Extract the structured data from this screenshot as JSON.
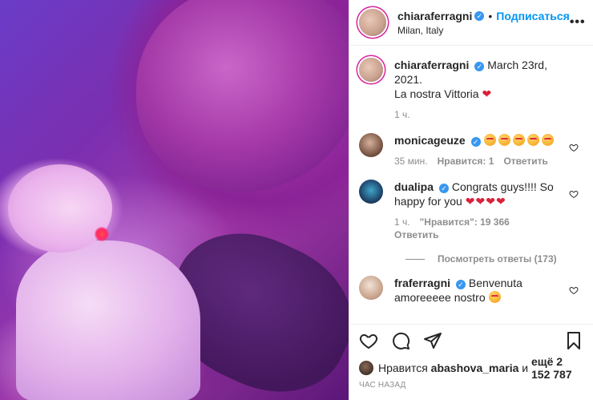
{
  "header": {
    "username": "chiaraferragni",
    "separator": "•",
    "follow_label": "Подписаться",
    "location": "Milan, Italy"
  },
  "caption": {
    "username": "chiaraferragni",
    "line1": "March 23rd, 2021.",
    "line2": "La nostra Vittoria",
    "time": "1 ч."
  },
  "comments": [
    {
      "username": "monicageuze",
      "text": "",
      "emoji_count": 5,
      "time": "35 мин.",
      "likes": "Нравится: 1",
      "reply": "Ответить"
    },
    {
      "username": "dualipa",
      "text": "Congrats guys!!!! So happy for you",
      "hearts": 4,
      "time": "1 ч.",
      "likes": "\"Нравится\": 19 366",
      "reply": "Ответить"
    },
    {
      "username": "fraferragni",
      "text": "Benvenuta amoreeeee nostro"
    }
  ],
  "view_replies_label": "Посмотреть ответы (173)",
  "likes_line": {
    "prefix": "Нравится",
    "user": "abashova_maria",
    "middle": "и",
    "others": "ещё 2 152 787"
  },
  "time_ago": "ЧАС НАЗАД",
  "icons": [
    "verified-badge-icon",
    "more-icon",
    "heart-icon",
    "comment-icon",
    "share-icon",
    "save-icon"
  ],
  "colors": {
    "link_blue": "#0095f6",
    "verified_blue": "#3897f0",
    "muted": "#8e8e8e"
  }
}
